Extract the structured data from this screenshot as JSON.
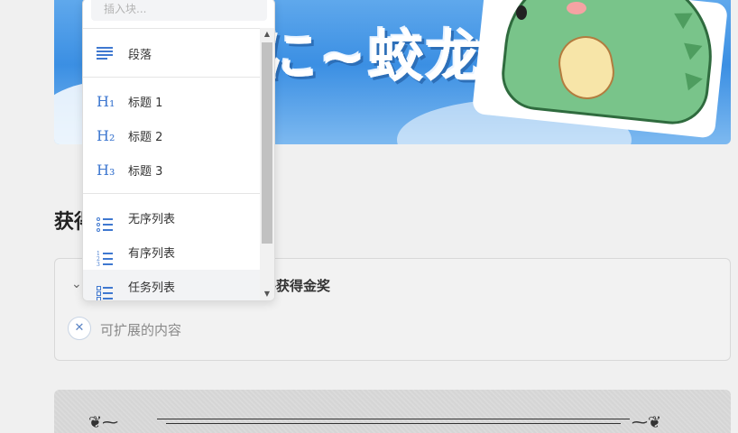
{
  "banner": {
    "title": "に~蛟龙",
    "colors": {
      "sky": "#3b8fe3",
      "dino": "#79c48a"
    }
  },
  "section": {
    "heading": "获得"
  },
  "card": {
    "title": "件获得金奖",
    "content": "可扩展的内容",
    "remove_icon": "close-icon",
    "toggle_icon": "chevron-down-icon"
  },
  "menu": {
    "search_placeholder": "插入块...",
    "items": [
      {
        "label": "段落",
        "icon": "paragraph-icon"
      },
      {
        "label": "标题 1",
        "icon": "heading-1-icon",
        "glyph": "H₁"
      },
      {
        "label": "标题 2",
        "icon": "heading-2-icon",
        "glyph": "H₂"
      },
      {
        "label": "标题 3",
        "icon": "heading-3-icon",
        "glyph": "H₃"
      },
      {
        "label": "无序列表",
        "icon": "bullet-list-icon"
      },
      {
        "label": "有序列表",
        "icon": "ordered-list-icon"
      },
      {
        "label": "任务列表",
        "icon": "task-list-icon"
      }
    ],
    "accent": "#3f78d0"
  }
}
